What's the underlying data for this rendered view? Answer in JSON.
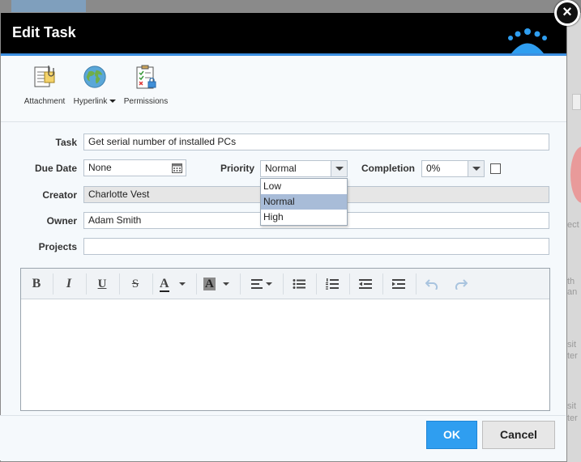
{
  "dialog": {
    "title": "Edit Task",
    "close_symbol": "×"
  },
  "toolbar": {
    "attachment_label": "Attachment",
    "hyperlink_label": "Hyperlink",
    "permissions_label": "Permissions"
  },
  "form": {
    "task": {
      "label": "Task",
      "value": "Get serial number of installed PCs"
    },
    "due_date": {
      "label": "Due Date",
      "value": "None"
    },
    "priority": {
      "label": "Priority",
      "value": "Normal",
      "options": [
        "Low",
        "Normal",
        "High"
      ],
      "highlighted": "Normal"
    },
    "completion": {
      "label": "Completion",
      "value": "0%"
    },
    "creator": {
      "label": "Creator",
      "value": "Charlotte Vest"
    },
    "owner": {
      "label": "Owner",
      "value": "Adam Smith"
    },
    "projects": {
      "label": "Projects",
      "value": ""
    }
  },
  "editor": {
    "bold_label": "B",
    "italic_label": "I",
    "underline_label": "U",
    "strike_label": "S",
    "font_color_label": "A",
    "highlight_label": "A",
    "content": ""
  },
  "footer": {
    "ok_label": "OK",
    "cancel_label": "Cancel"
  },
  "background": {
    "fragments": [
      "ect",
      "th",
      "an",
      "sit",
      "ter",
      "sit",
      "ter"
    ]
  },
  "colors": {
    "header_bg": "#000000",
    "accent": "#3c8fe0",
    "ok_button": "#2f9ef0",
    "dropdown_highlight": "#a8bcd8"
  }
}
